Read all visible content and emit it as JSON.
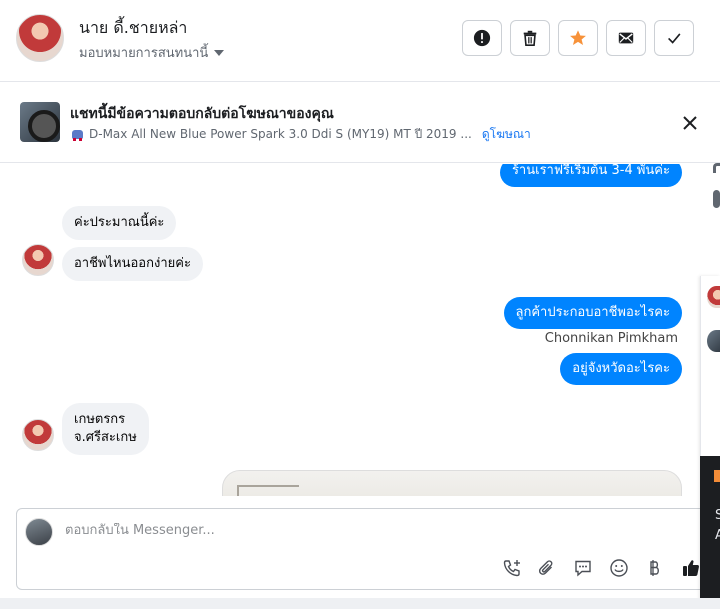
{
  "header": {
    "contact_name": "นาย ดี้.ชายหล่า",
    "assign_label": "มอบหมายการสนทนานี้"
  },
  "ad": {
    "title": "แชทนี้มีข้อความตอบกลับต่อโฆษณาของคุณ",
    "product": "D-Max All New Blue Power Spark 3.0 Ddi S (MY19) MT ปี 2019 ...",
    "view_link": "ดูโฆษณา"
  },
  "messages": {
    "out_1": "ร้านเราฟรีเริ่มต้น 3-4 พันค่ะ",
    "in_1": "ค่ะประมาณนี้ค่ะ",
    "in_2": "อาชีพไหนออกง่ายค่ะ",
    "out_2": "ลูกค้าประกอบอาชีพอะไรคะ",
    "sender": "Chonnikan Pimkham",
    "out_3": "อยู่จังหวัดอะไรคะ",
    "in_3_line1": "เกษตรกร",
    "in_3_line2": "จ.ศรีสะเกษ"
  },
  "composer": {
    "placeholder": "ตอบกลับใน Messenger..."
  },
  "side_panel": {
    "letter_1": "S",
    "letter_2": "A"
  },
  "icons": {
    "header_actions": [
      "alert-icon",
      "trash-icon",
      "star-icon",
      "mail-icon",
      "check-icon"
    ],
    "composer_tools": [
      "call-add-icon",
      "paperclip-icon",
      "chat-bubble-icon",
      "emoji-icon",
      "baht-icon",
      "like-icon"
    ]
  },
  "colors": {
    "accent": "#0084ff",
    "star": "#f7923a",
    "link": "#1877f2"
  }
}
